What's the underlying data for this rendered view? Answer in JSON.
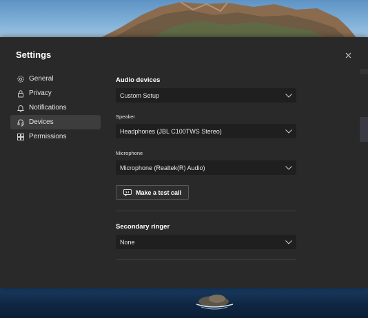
{
  "dialog": {
    "title": "Settings"
  },
  "nav": {
    "items": [
      {
        "label": "General",
        "icon": "gear-icon"
      },
      {
        "label": "Privacy",
        "icon": "lock-icon"
      },
      {
        "label": "Notifications",
        "icon": "bell-icon"
      },
      {
        "label": "Devices",
        "icon": "headset-icon",
        "active": true
      },
      {
        "label": "Permissions",
        "icon": "apps-grid-icon"
      }
    ]
  },
  "devices": {
    "audio_title": "Audio devices",
    "audio_value": "Custom Setup",
    "speaker_label": "Speaker",
    "speaker_value": "Headphones (JBL C100TWS Stereo)",
    "microphone_label": "Microphone",
    "microphone_value": "Microphone (Realtek(R) Audio)",
    "test_call_label": "Make a test call",
    "secondary_title": "Secondary ringer",
    "secondary_value": "None"
  },
  "colors": {
    "dialog_bg": "#292929",
    "select_bg": "#1f1f1f",
    "active_nav_bg": "#3d3d3d",
    "text": "#e5e5e5"
  }
}
